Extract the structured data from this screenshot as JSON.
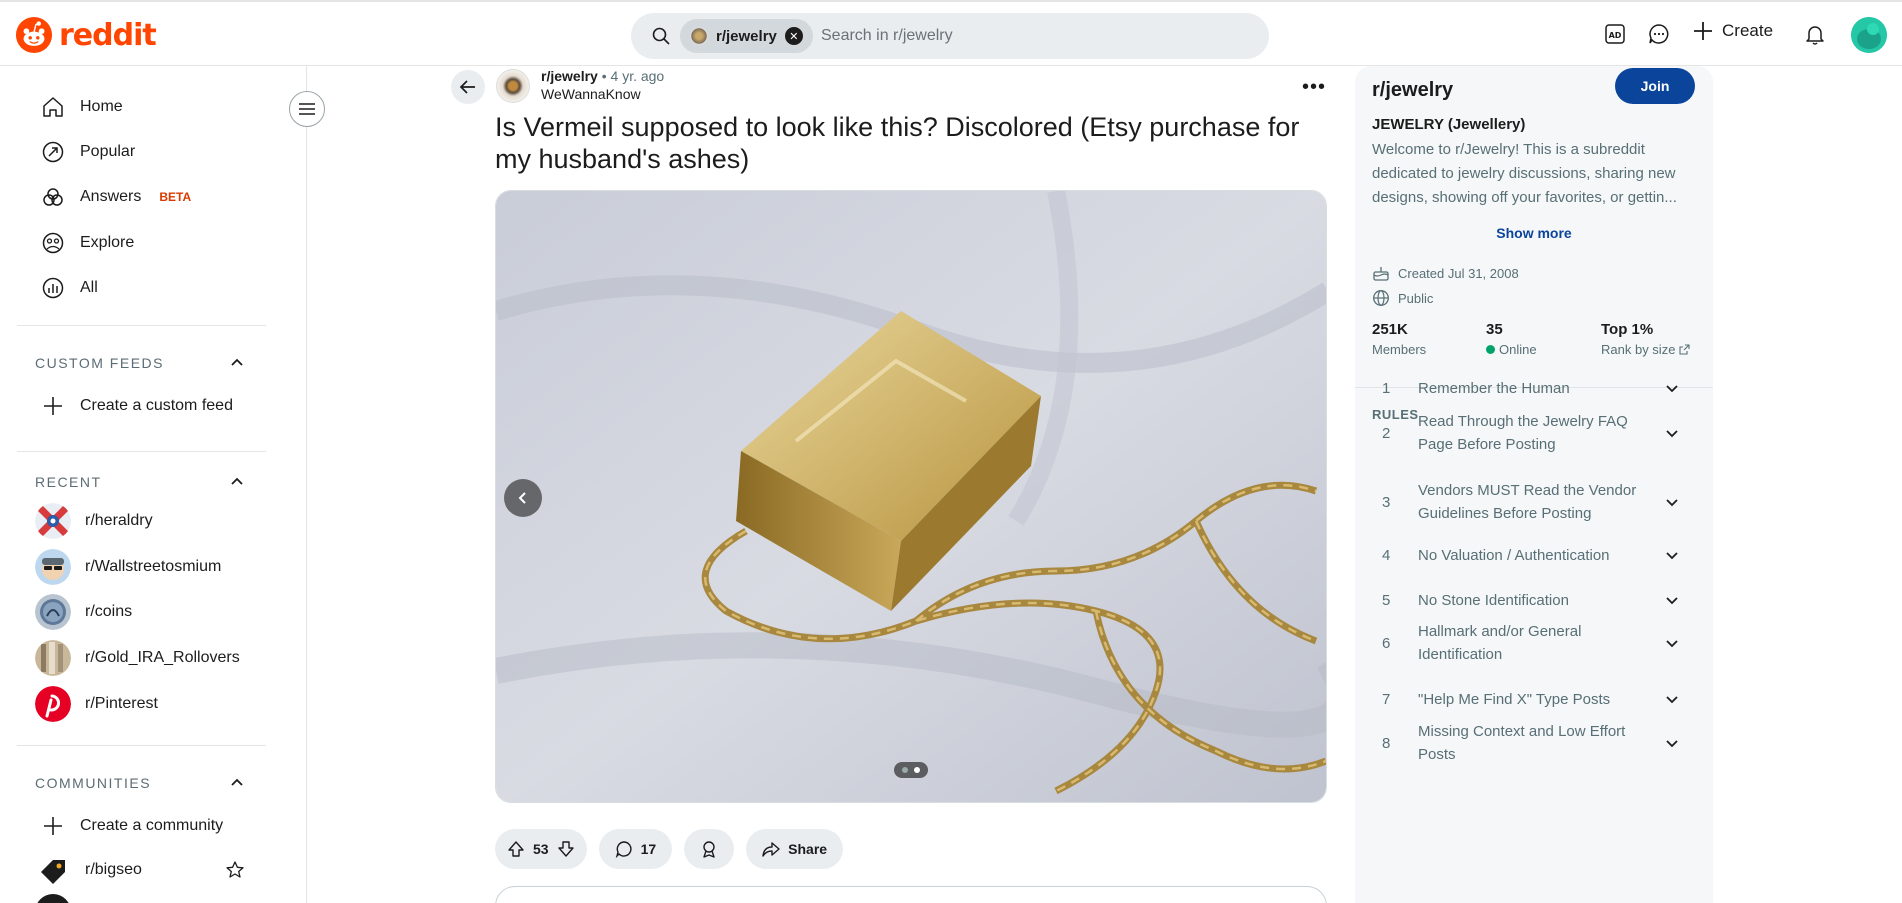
{
  "header": {
    "logo_text": "reddit",
    "search": {
      "chip_label": "r/jewelry",
      "placeholder": "Search in r/jewelry"
    },
    "create_label": "Create",
    "icons": [
      "advertise-icon",
      "chat-icon",
      "plus-icon",
      "notification-bell-icon",
      "user-avatar"
    ],
    "brand_color": "#ff4500"
  },
  "sidebar": {
    "nav": [
      {
        "label": "Home",
        "icon": "home-icon"
      },
      {
        "label": "Popular",
        "icon": "popular-icon"
      },
      {
        "label": "Answers",
        "badge": "BETA",
        "icon": "answers-icon"
      },
      {
        "label": "Explore",
        "icon": "explore-icon"
      },
      {
        "label": "All",
        "icon": "all-icon"
      }
    ],
    "custom_feeds": {
      "heading": "CUSTOM FEEDS",
      "create_label": "Create a custom feed"
    },
    "recent": {
      "heading": "RECENT",
      "items": [
        "r/heraldry",
        "r/Wallstreetosmium",
        "r/coins",
        "r/Gold_IRA_Rollovers",
        "r/Pinterest"
      ]
    },
    "communities": {
      "heading": "COMMUNITIES",
      "create_label": "Create a community",
      "items": [
        "r/bigseo"
      ]
    }
  },
  "post": {
    "subreddit": "r/jewelry",
    "age": "4 yr. ago",
    "author": "WeWannaKnow",
    "title": "Is Vermeil supposed to look like this? Discolored (Etsy purchase for my husband's ashes)",
    "gallery": {
      "count": 2,
      "current": 2
    },
    "votes": "53",
    "comments": "17",
    "share_label": "Share"
  },
  "community": {
    "name": "r/jewelry",
    "join_label": "Join",
    "full_name": "JEWELRY (Jewellery)",
    "description": "Welcome to r/Jewelry! This is a subreddit dedicated to jewelry discussions, sharing new designs, showing off your favorites, or gettin...",
    "show_more": "Show more",
    "created": "Created Jul 31, 2008",
    "visibility": "Public",
    "stats": [
      {
        "value": "251K",
        "label": "Members"
      },
      {
        "value": "35",
        "label": "Online"
      },
      {
        "value": "Top 1%",
        "label": "Rank by size"
      }
    ],
    "rules_heading": "RULES",
    "rules": [
      {
        "num": "1",
        "text": "Remember the Human"
      },
      {
        "num": "2",
        "text": "Read Through the Jewelry FAQ Page Before Posting"
      },
      {
        "num": "3",
        "text": "Vendors MUST Read the Vendor Guidelines Before Posting"
      },
      {
        "num": "4",
        "text": "No Valuation / Authentication"
      },
      {
        "num": "5",
        "text": "No Stone Identification"
      },
      {
        "num": "6",
        "text": "Hallmark and/or General Identification"
      },
      {
        "num": "7",
        "text": "\"Help Me Find X\" Type Posts"
      },
      {
        "num": "8",
        "text": "Missing Context and Low Effort Posts"
      }
    ],
    "accent_color": "#0a449b"
  }
}
